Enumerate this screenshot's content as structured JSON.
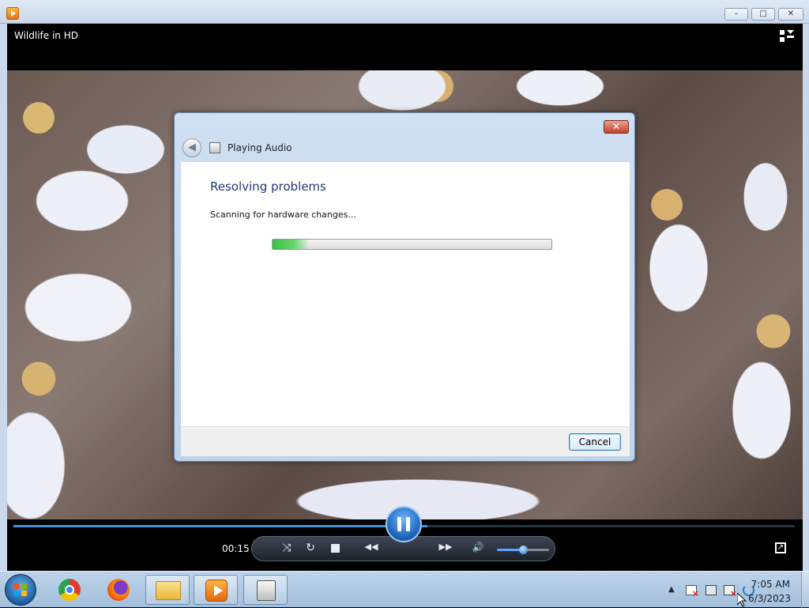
{
  "window": {
    "controls": {
      "minimize": "–",
      "maximize": "□",
      "close": "✕"
    }
  },
  "player": {
    "video_title": "Wildlife in HD",
    "elapsed_time": "00:15",
    "seek_progress_fraction": 0.53,
    "volume_fraction": 0.5,
    "icons": {
      "shuffle": "⤨",
      "repeat": "↻",
      "previous": "◀◀",
      "next": "▶▶",
      "mute": "🔊",
      "fullscreen": "↗"
    }
  },
  "dialog": {
    "title": "Playing Audio",
    "heading": "Resolving problems",
    "status": "Scanning for hardware changes...",
    "progress_fraction": 0.13,
    "cancel_label": "Cancel",
    "close_glyph": "✕",
    "back_glyph": "◀"
  },
  "taskbar": {
    "items": [
      {
        "id": "chrome",
        "icon": "chrome-icon"
      },
      {
        "id": "firefox",
        "icon": "firefox-icon"
      },
      {
        "id": "explorer",
        "icon": "folder-icon"
      },
      {
        "id": "wmp",
        "icon": "media-player-icon"
      },
      {
        "id": "troubleshooter",
        "icon": "troubleshooter-icon"
      }
    ],
    "tray_arrow": "▲",
    "clock": {
      "time": "7:05 AM",
      "date": "6/3/2023"
    }
  }
}
